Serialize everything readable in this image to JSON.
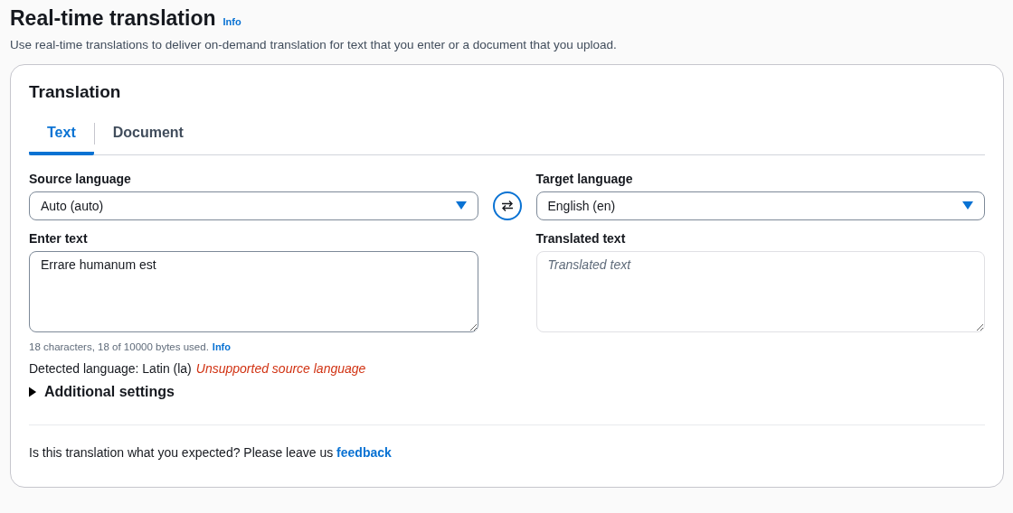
{
  "header": {
    "title": "Real-time translation",
    "info_link": "Info",
    "description": "Use real-time translations to deliver on-demand translation for text that you enter or a document that you upload."
  },
  "panel": {
    "title": "Translation",
    "tabs": [
      {
        "label": "Text",
        "selected": true
      },
      {
        "label": "Document",
        "selected": false
      }
    ],
    "source_language": {
      "label": "Source language",
      "value": "Auto (auto)"
    },
    "target_language": {
      "label": "Target language",
      "value": "English (en)"
    },
    "input": {
      "label": "Enter text",
      "value": "Errare humanum est",
      "counter": "18 characters, 18 of 10000 bytes used.",
      "info_link": "Info"
    },
    "output": {
      "label": "Translated text",
      "placeholder": "Translated text"
    },
    "detected": {
      "text": "Detected language: Latin (la)",
      "warning": "Unsupported source language"
    },
    "additional_settings": {
      "label": "Additional settings",
      "expanded": false
    },
    "feedback": {
      "text": "Is this translation what you expected? Please leave us",
      "link": "feedback"
    }
  }
}
